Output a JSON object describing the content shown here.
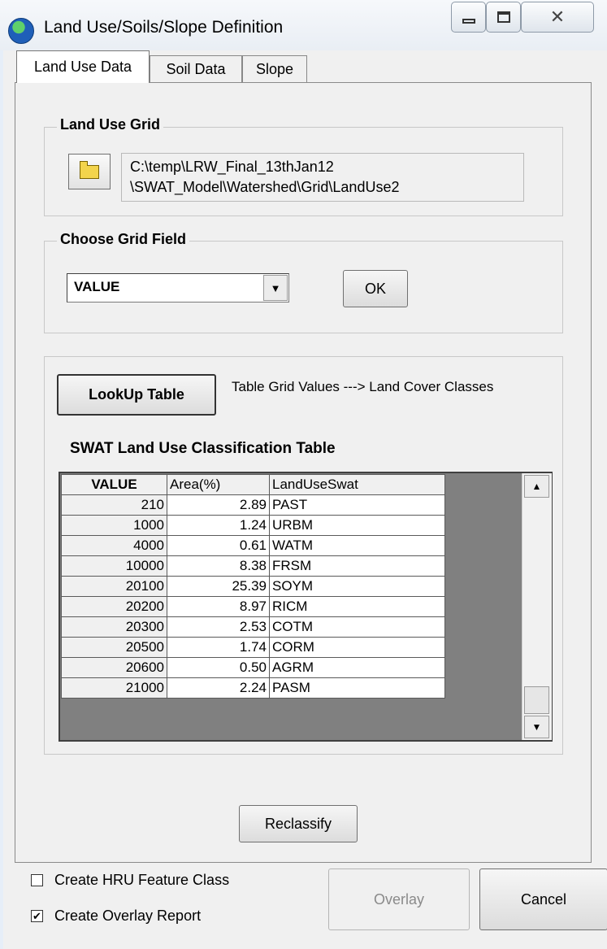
{
  "window": {
    "title": "Land Use/Soils/Slope Definition",
    "close_glyph": "✕"
  },
  "tabs": [
    {
      "label": "Land Use Data",
      "active": true
    },
    {
      "label": "Soil Data",
      "active": false
    },
    {
      "label": "Slope",
      "active": false
    }
  ],
  "land_use_grid": {
    "legend": "Land Use Grid",
    "path_line1": "C:\\temp\\LRW_Final_13thJan12",
    "path_line2": "\\SWAT_Model\\Watershed\\Grid\\LandUse2"
  },
  "choose_grid_field": {
    "legend": "Choose Grid Field",
    "selected": "VALUE",
    "ok_label": "OK"
  },
  "lookup": {
    "button_label": "LookUp Table",
    "description": "Table Grid Values ---> Land Cover Classes"
  },
  "classification_table": {
    "title": "SWAT Land Use Classification Table",
    "headers": [
      "VALUE",
      "Area(%)",
      "LandUseSwat"
    ],
    "rows": [
      [
        "210",
        "2.89",
        "PAST"
      ],
      [
        "1000",
        "1.24",
        "URBM"
      ],
      [
        "4000",
        "0.61",
        "WATM"
      ],
      [
        "10000",
        "8.38",
        "FRSM"
      ],
      [
        "20100",
        "25.39",
        "SOYM"
      ],
      [
        "20200",
        "8.97",
        "RICM"
      ],
      [
        "20300",
        "2.53",
        "COTM"
      ],
      [
        "20500",
        "1.74",
        "CORM"
      ],
      [
        "20600",
        "0.50",
        "AGRM"
      ],
      [
        "21000",
        "2.24",
        "PASM"
      ]
    ]
  },
  "reclassify_label": "Reclassify",
  "options": {
    "create_hru": {
      "label": "Create HRU Feature Class",
      "checked": false
    },
    "create_report": {
      "label": "Create Overlay Report",
      "checked": true
    }
  },
  "overlay_label": "Overlay",
  "cancel_label": "Cancel",
  "glyphs": {
    "check": "✔",
    "up": "▲",
    "down": "▼"
  }
}
